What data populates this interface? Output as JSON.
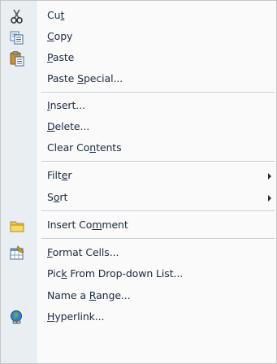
{
  "menu": {
    "cut": {
      "pre": "Cu",
      "acc": "t",
      "post": "",
      "icon": "scissors-icon"
    },
    "copy": {
      "pre": "",
      "acc": "C",
      "post": "opy",
      "icon": "copy-icon"
    },
    "paste": {
      "pre": "",
      "acc": "P",
      "post": "aste",
      "icon": "paste-icon"
    },
    "paste_special": {
      "pre": "Paste ",
      "acc": "S",
      "post": "pecial..."
    },
    "insert": {
      "pre": "",
      "acc": "I",
      "post": "nsert..."
    },
    "delete": {
      "pre": "",
      "acc": "D",
      "post": "elete..."
    },
    "clear_contents": {
      "pre": "Clear Co",
      "acc": "n",
      "post": "tents"
    },
    "filter": {
      "pre": "Filt",
      "acc": "e",
      "post": "r"
    },
    "sort": {
      "pre": "S",
      "acc": "o",
      "post": "rt"
    },
    "insert_comment": {
      "pre": "Insert Co",
      "acc": "m",
      "post": "ment",
      "icon": "folder-comment-icon"
    },
    "format_cells": {
      "pre": "",
      "acc": "F",
      "post": "ormat Cells...",
      "icon": "format-cells-icon"
    },
    "pick_from_list": {
      "pre": "Pic",
      "acc": "k",
      "post": " From Drop-down List..."
    },
    "name_range": {
      "pre": "Name a ",
      "acc": "R",
      "post": "ange..."
    },
    "hyperlink": {
      "pre": "",
      "acc": "H",
      "post": "yperlink...",
      "icon": "hyperlink-icon"
    }
  }
}
